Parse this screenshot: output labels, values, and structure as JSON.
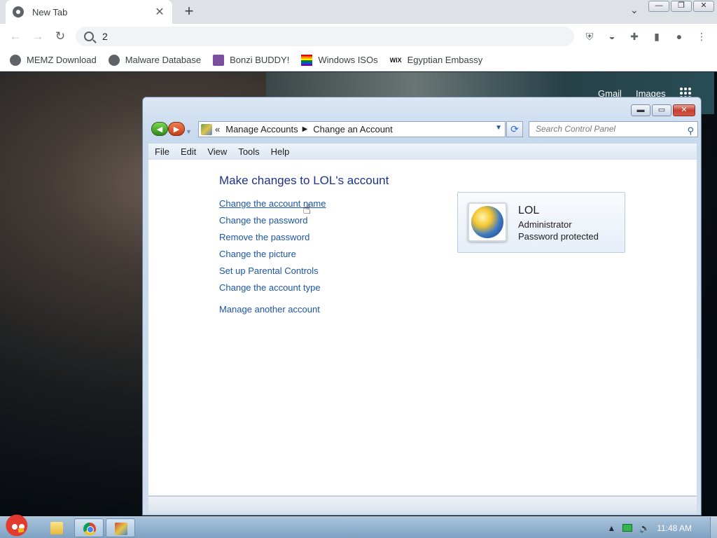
{
  "browser": {
    "tab_title": "New Tab",
    "tab_close": "✕",
    "new_tab": "+",
    "omnibox_text": "2",
    "bookmarks": [
      {
        "label": "MEMZ Download",
        "icon": "globe-icon"
      },
      {
        "label": "Malware Database",
        "icon": "globe-icon"
      },
      {
        "label": "Bonzi BUDDY!",
        "icon": "bonzi-icon"
      },
      {
        "label": "Windows ISOs",
        "icon": "rainbow-flag-icon"
      },
      {
        "label": "Egyptian Embassy",
        "icon": "wix-icon",
        "icon_text": "WIX"
      }
    ]
  },
  "google": {
    "gmail": "Gmail",
    "images": "Images"
  },
  "window": {
    "breadcrumb": [
      "Manage Accounts",
      "Change an Account"
    ],
    "breadcrumb_prefix": "«",
    "search_placeholder": "Search Control Panel",
    "menu": [
      "File",
      "Edit",
      "View",
      "Tools",
      "Help"
    ],
    "heading": "Make changes to LOL's account",
    "tasks": [
      "Change the account name",
      "Change the password",
      "Remove the password",
      "Change the picture",
      "Set up Parental Controls",
      "Change the account type"
    ],
    "manage_other": "Manage another account",
    "account": {
      "name": "LOL",
      "type": "Administrator",
      "status": "Password protected"
    }
  },
  "taskbar": {
    "clock": "11:48 AM"
  },
  "colors": {
    "link": "#1c56a6",
    "heading": "#1e3287",
    "close_button": "#c4402e"
  }
}
